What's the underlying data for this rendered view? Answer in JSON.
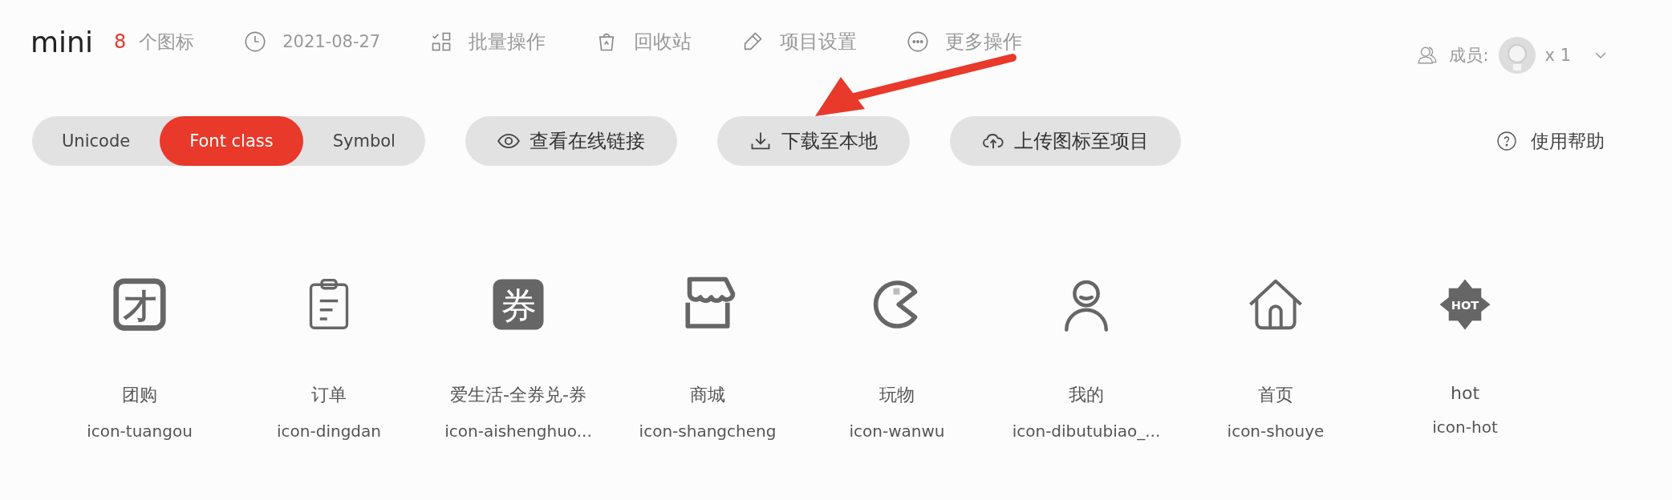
{
  "project": {
    "title": "mini",
    "count": "8",
    "count_label": "个图标",
    "date": "2021-08-27"
  },
  "actions": [
    {
      "kind": "batch",
      "label": "批量操作"
    },
    {
      "kind": "trash",
      "label": "回收站"
    },
    {
      "kind": "settings",
      "label": "项目设置"
    },
    {
      "kind": "more",
      "label": "更多操作"
    }
  ],
  "members": {
    "label": "成员:",
    "count": "x 1"
  },
  "tabs": [
    {
      "label": "Unicode",
      "selected": false
    },
    {
      "label": "Font class",
      "selected": true
    },
    {
      "label": "Symbol",
      "selected": false
    }
  ],
  "buttons": [
    {
      "kind": "view",
      "label": "查看在线链接"
    },
    {
      "kind": "download",
      "label": "下载至本地"
    },
    {
      "kind": "upload",
      "label": "上传图标至项目"
    }
  ],
  "help": "使用帮助",
  "icons": [
    {
      "kind": "tuan",
      "glyph": "才",
      "name": "团购",
      "class": "icon-tuangou"
    },
    {
      "kind": "clipboard",
      "name": "订单",
      "class": "icon-dingdan"
    },
    {
      "kind": "coupon",
      "glyph": "券",
      "name": "爱生活-全券兑-券",
      "class": "icon-aishenghuo..."
    },
    {
      "kind": "shop",
      "name": "商城",
      "class": "icon-shangcheng"
    },
    {
      "kind": "pacman",
      "name": "玩物",
      "class": "icon-wanwu"
    },
    {
      "kind": "person",
      "name": "我的",
      "class": "icon-dibutubiao_..."
    },
    {
      "kind": "home",
      "name": "首页",
      "class": "icon-shouye"
    },
    {
      "kind": "hot",
      "glyph": "HOT",
      "name": "hot",
      "class": "icon-hot"
    }
  ]
}
